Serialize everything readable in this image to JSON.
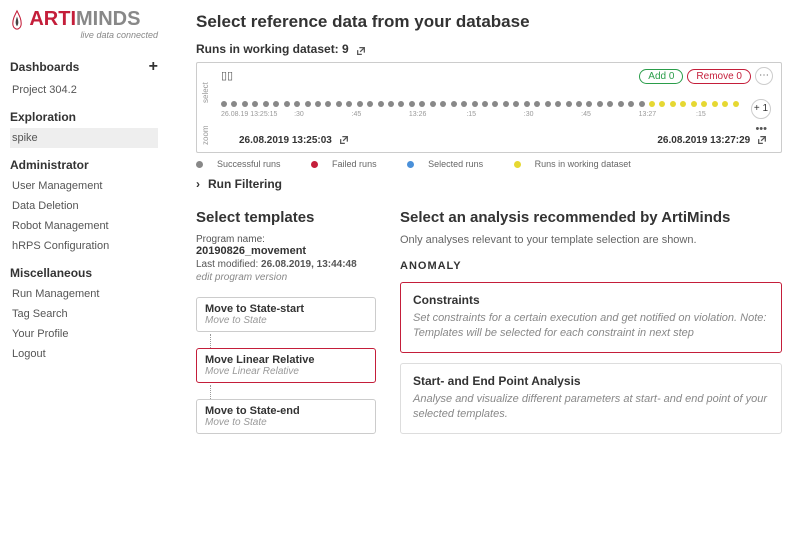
{
  "logo": {
    "text1": "ARTI",
    "text2": "MINDS",
    "tag": "live data connected"
  },
  "nav": {
    "dashboards": {
      "head": "Dashboards",
      "items": [
        "Project 304.2"
      ]
    },
    "exploration": {
      "head": "Exploration",
      "items": [
        "spike"
      ]
    },
    "admin": {
      "head": "Administrator",
      "items": [
        "User Management",
        "Data Deletion",
        "Robot Management",
        "hRPS Configuration"
      ]
    },
    "misc": {
      "head": "Miscellaneous",
      "items": [
        "Run Management",
        "Tag Search",
        "Your Profile",
        "Logout"
      ]
    }
  },
  "main": {
    "title": "Select reference data from your database",
    "runs_label": "Runs in working dataset:",
    "runs_count": "9",
    "btn_add": "Add 0",
    "btn_remove": "Remove 0",
    "btn_plus": "+ 1",
    "time_start": "26.08.2019 13:25:03",
    "time_end": "26.08.2019 13:27:29",
    "axis_start": "26.08.19 13:25:15",
    "ticks": [
      ":30",
      ":45",
      "13:26",
      ":15",
      ":30",
      ":45",
      "13:27",
      ":15"
    ],
    "legend": {
      "succ": "Successful runs",
      "fail": "Failed runs",
      "sel": "Selected runs",
      "work": "Runs in working dataset"
    },
    "filter": "Run Filtering"
  },
  "templates": {
    "title": "Select templates",
    "prog_label": "Program name:",
    "prog_name": "20190826_movement",
    "mod_label": "Last modified: ",
    "mod_value": "26.08.2019, 13:44:48",
    "edit": "edit program version",
    "nodes": [
      {
        "t": "Move to State-start",
        "s": "Move to State",
        "red": false
      },
      {
        "t": "Move Linear Relative",
        "s": "Move Linear Relative",
        "red": true
      },
      {
        "t": "Move to State-end",
        "s": "Move to State",
        "red": false
      }
    ]
  },
  "analysis": {
    "title": "Select an analysis recommended by ArtiMinds",
    "sub": "Only analyses relevant to your template selection are shown.",
    "cat": "ANOMALY",
    "cards": [
      {
        "t": "Constraints",
        "d": "Set constraints for a certain execution and get notified on violation. Note: Templates will be selected for each constraint in next step",
        "red": true
      },
      {
        "t": "Start- and End Point Analysis",
        "d": "Analyse and visualize different parameters at start- and end point of your selected templates.",
        "red": false
      }
    ]
  }
}
